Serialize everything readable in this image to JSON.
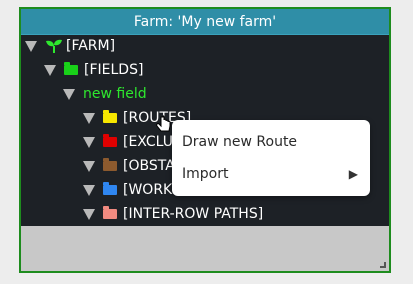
{
  "window": {
    "title": "Farm: 'My new farm'"
  },
  "tree": {
    "farm": {
      "label": "[FARM]",
      "icon": "sprout-icon",
      "color": "#2ee82e"
    },
    "fields": {
      "label": "[FIELDS]",
      "icon": "folder-icon",
      "color": "#19d119"
    },
    "field": {
      "label": "new field"
    },
    "children": [
      {
        "label": "[ROUTES]",
        "color": "#f7e600"
      },
      {
        "label": "[EXCLU",
        "color": "#e00000"
      },
      {
        "label": "[OBSTA",
        "color": "#8c5a2e"
      },
      {
        "label": "[WORK",
        "color": "#2f86f0"
      },
      {
        "label": "[INTER-ROW PATHS]",
        "color": "#f08a80"
      }
    ]
  },
  "context_menu": {
    "items": [
      {
        "label": "Draw new Route"
      },
      {
        "label": "Import",
        "submenu_arrow": "▶"
      }
    ]
  }
}
